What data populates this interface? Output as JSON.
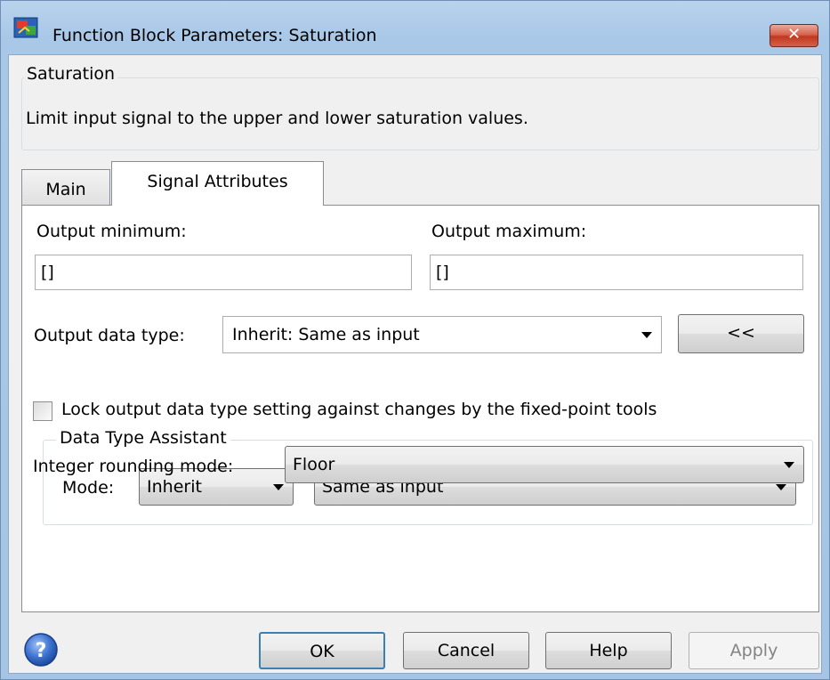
{
  "window": {
    "title": "Function Block Parameters: Saturation",
    "close_label": "✕"
  },
  "description": {
    "group_title": "Saturation",
    "text": "Limit input signal to the upper and lower saturation values."
  },
  "tabs": [
    {
      "label": "Main",
      "selected": false
    },
    {
      "label": "Signal Attributes",
      "selected": true
    }
  ],
  "signal_attributes": {
    "output_minimum_label": "Output minimum:",
    "output_minimum_value": "[]",
    "output_maximum_label": "Output maximum:",
    "output_maximum_value": "[]",
    "output_data_type_label": "Output data type:",
    "output_data_type_value": "Inherit: Same as input",
    "assistant_toggle_label": "<<",
    "data_type_assistant": {
      "group_title": "Data Type Assistant",
      "mode_label": "Mode:",
      "mode_value": "Inherit",
      "inherit_value": "Same as input"
    },
    "lock_checkbox_label": "Lock output data type setting against changes by the fixed-point tools",
    "lock_checked": false,
    "rounding_label": "Integer rounding mode:",
    "rounding_value": "Floor"
  },
  "buttons": {
    "ok": "OK",
    "cancel": "Cancel",
    "help": "Help",
    "apply": "Apply"
  },
  "icons": {
    "app_icon": "simulink-block-icon",
    "help_icon": "question-icon"
  },
  "colors": {
    "title_bar": "#a9c8e8",
    "close_button": "#c0391f",
    "default_button_border": "#3c7fb1"
  }
}
